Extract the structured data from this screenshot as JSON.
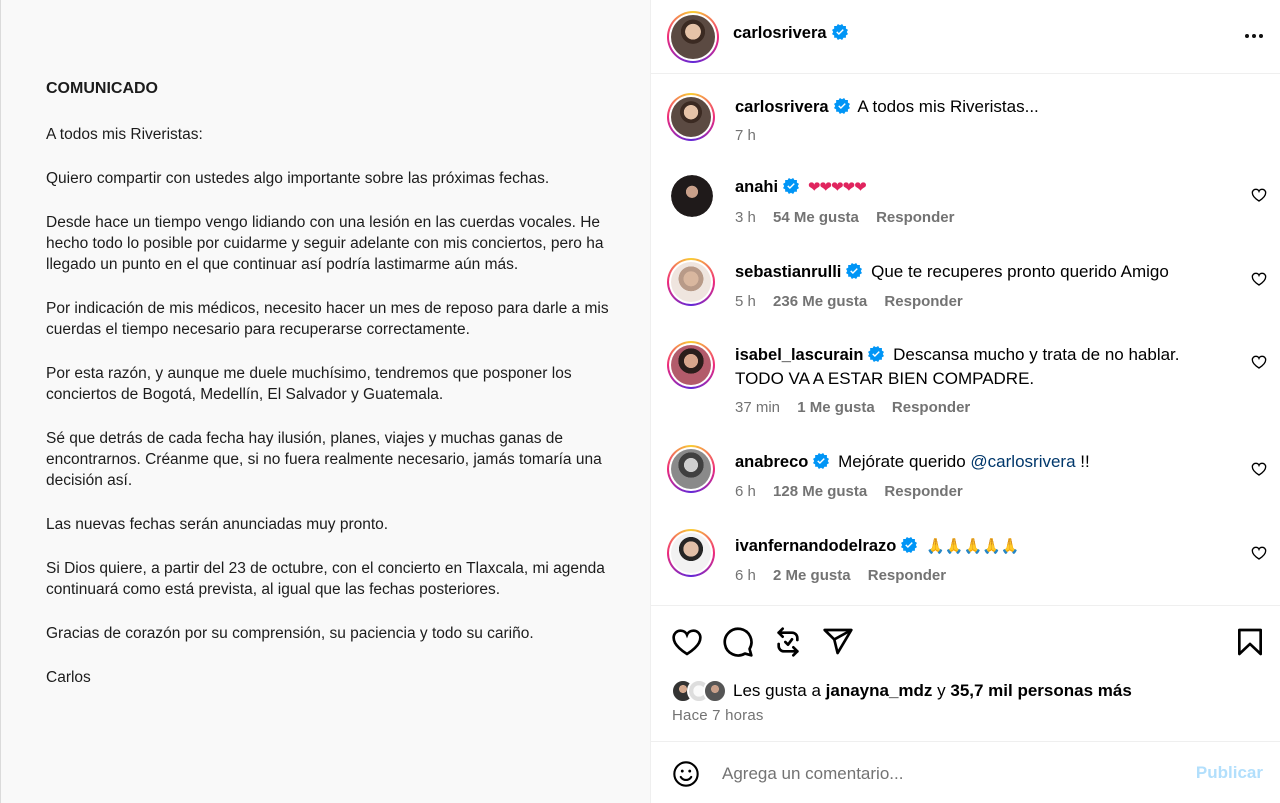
{
  "statement": {
    "title": "COMUNICADO",
    "paragraphs": [
      "A todos mis Riveristas:",
      "Quiero compartir con ustedes algo importante sobre las próximas fechas.",
      "Desde hace un tiempo vengo lidiando con una lesión en las cuerdas vocales. He hecho todo lo posible por cuidarme y seguir adelante con mis conciertos, pero ha llegado un punto en el que continuar así podría lastimarme aún más.",
      "Por indicación de mis médicos, necesito hacer un mes de reposo para darle a mis cuerdas el tiempo necesario para recuperarse correctamente.",
      "Por esta razón, y aunque me duele muchísimo, tendremos que posponer los conciertos de Bogotá, Medellín, El Salvador y Guatemala.",
      "Sé que detrás de cada fecha hay ilusión, planes, viajes y muchas ganas de encontrarnos. Créanme que, si no fuera realmente necesario, jamás tomaría una decisión así.",
      "Las nuevas fechas serán anunciadas muy pronto.",
      "Si Dios quiere, a partir del 23 de octubre, con el concierto en Tlaxcala, mi agenda continuará como está prevista, al igual que las fechas posteriores.",
      "Gracias de corazón por su comprensión, su paciencia y todo su cariño.",
      "Carlos"
    ]
  },
  "header": {
    "username": "carlosrivera"
  },
  "caption": {
    "username": "carlosrivera",
    "text": "A todos mis Riveristas...",
    "time": "7 h"
  },
  "comments": [
    {
      "username": "anahi",
      "text": "❤❤❤❤❤",
      "time": "3 h",
      "likes": "54 Me gusta",
      "reply": "Responder"
    },
    {
      "username": "sebastianrulli",
      "text": "Que te recuperes pronto querido Amigo",
      "time": "5 h",
      "likes": "236 Me gusta",
      "reply": "Responder"
    },
    {
      "username": "isabel_lascurain",
      "text": "Descansa mucho y trata de no hablar. TODO VA A ESTAR BIEN COMPADRE.",
      "time": "37 min",
      "likes": "1 Me gusta",
      "reply": "Responder"
    },
    {
      "username": "anabreco",
      "text_before": "Mejórate querido",
      "mention": "@carlosrivera",
      "text_after": "!!",
      "time": "6 h",
      "likes": "128 Me gusta",
      "reply": "Responder"
    },
    {
      "username": "ivanfernandodelrazo",
      "text": "🙏🙏🙏🙏🙏",
      "time": "6 h",
      "likes": "2 Me gusta",
      "reply": "Responder"
    }
  ],
  "likes": {
    "prefix": "Les gusta a",
    "user": "janayna_mdz",
    "connector": "y",
    "others": "35,7 mil personas más"
  },
  "posted": "Hace 7 horas",
  "composer": {
    "placeholder": "Agrega un comentario...",
    "publish": "Publicar"
  },
  "icons": [
    "heart-icon",
    "comment-icon",
    "repost-icon",
    "share-icon",
    "bookmark-icon",
    "emoji-icon",
    "more-icon",
    "verified-icon"
  ],
  "colors": {
    "verified": "#0095f6",
    "publish_disabled": "#b2dffc",
    "secondary_text": "#737373",
    "mention": "#00376b"
  }
}
